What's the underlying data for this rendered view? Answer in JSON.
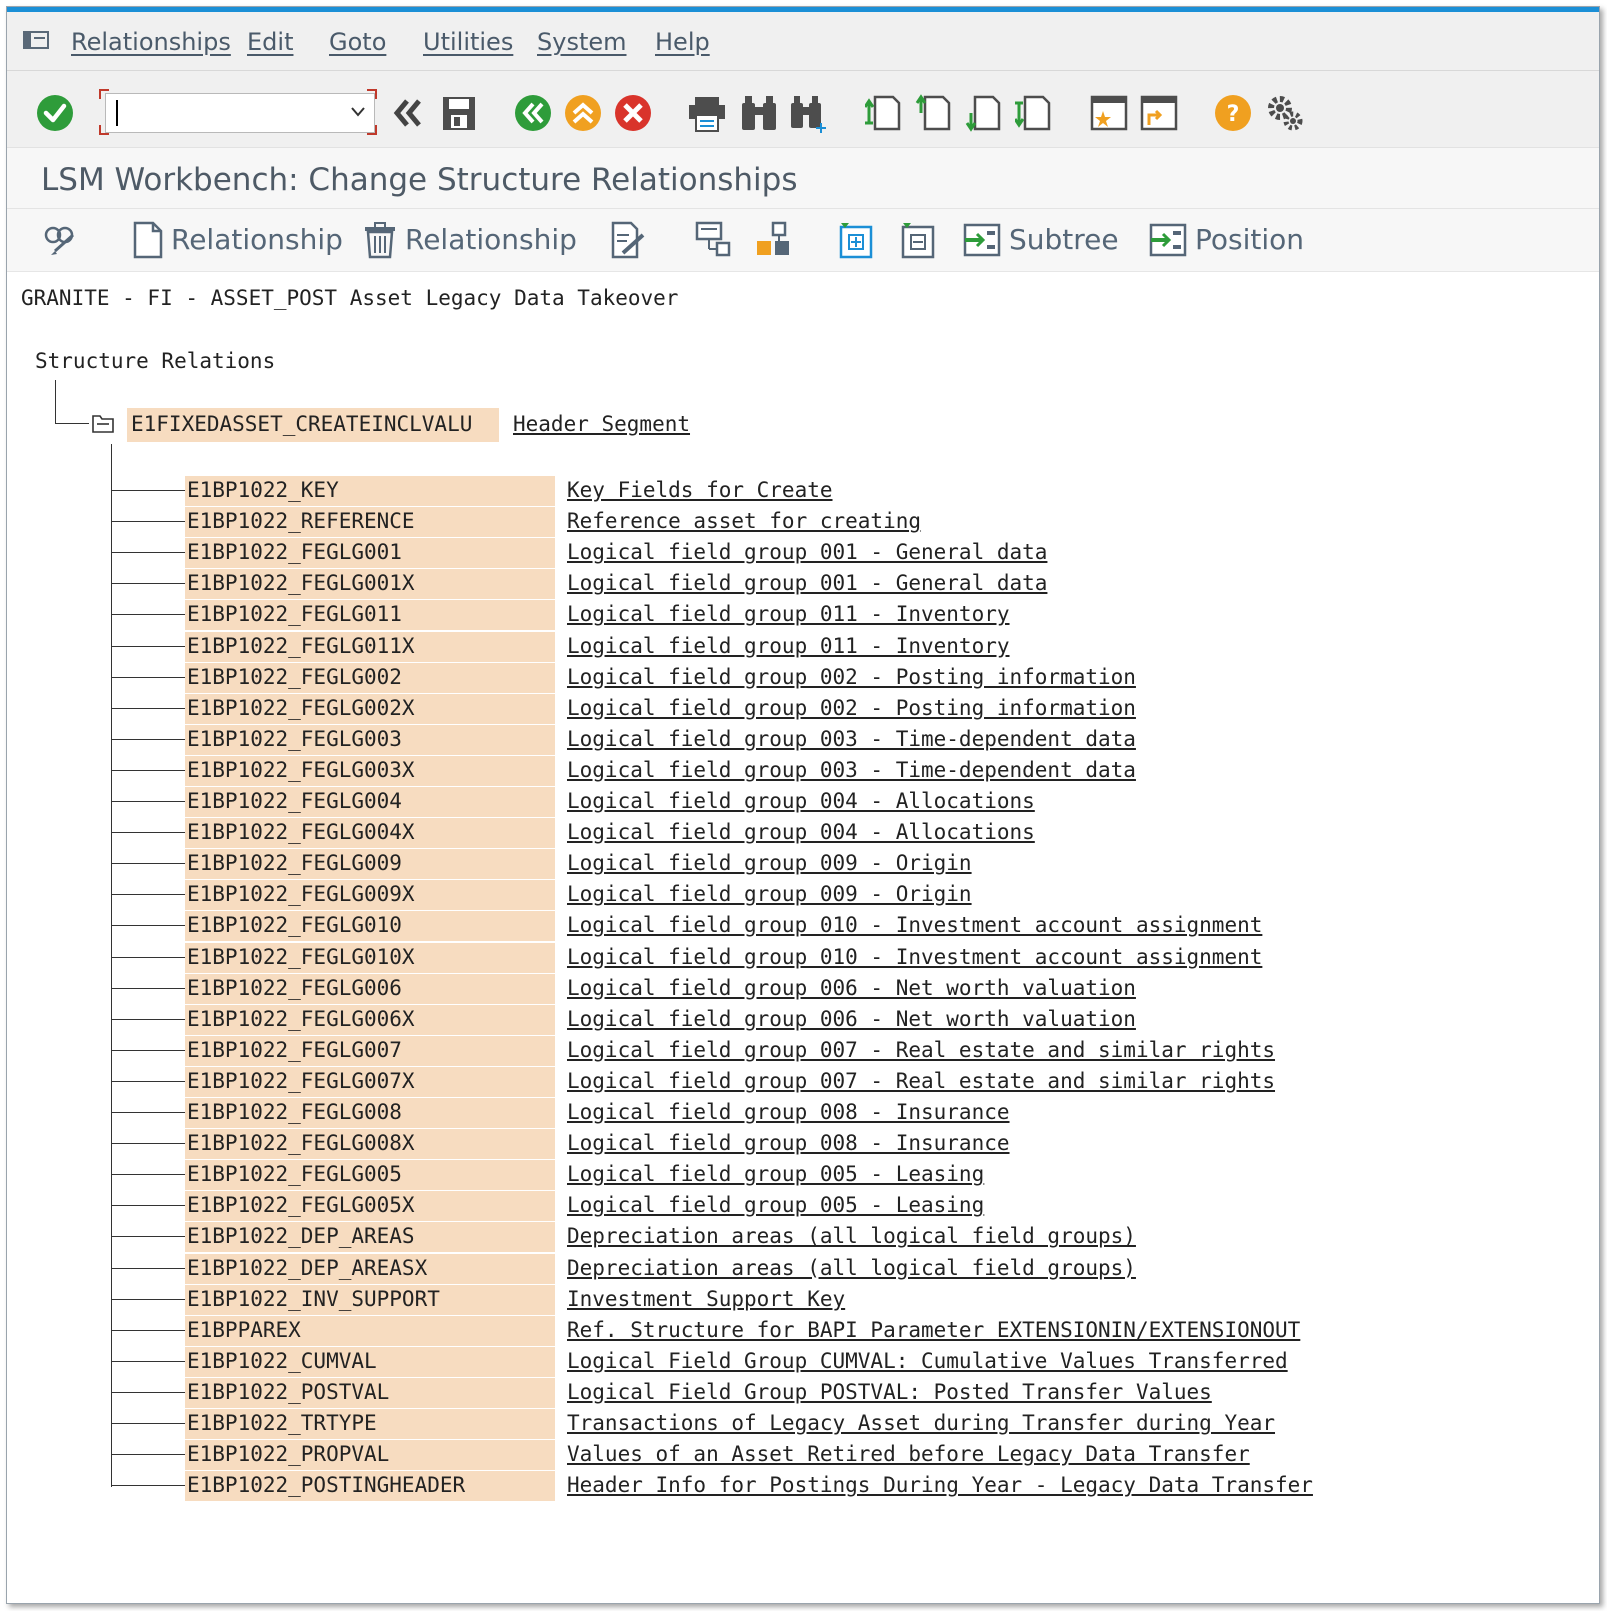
{
  "menubar": {
    "items": [
      "Relationships",
      "Edit",
      "Goto",
      "Utilities",
      "System",
      "Help"
    ]
  },
  "toolbar": {
    "command_field_value": "",
    "icons": [
      "enter-icon",
      "command-field",
      "back-double-icon",
      "save-icon",
      "back-icon",
      "exit-icon",
      "cancel-icon",
      "print-icon",
      "find-icon",
      "find-next-icon",
      "first-page-icon",
      "previous-page-icon",
      "next-page-icon",
      "last-page-icon",
      "create-session-icon",
      "generate-shortcut-icon",
      "help-icon",
      "customize-layout-icon"
    ]
  },
  "title_bar": {
    "title": "LSM Workbench: Change Structure Relationships"
  },
  "app_toolbar": {
    "create_relationship_label": "Relationship",
    "delete_relationship_label": "Relationship",
    "subtree_label": "Subtree",
    "position_label": "Position"
  },
  "content": {
    "heading": "GRANITE - FI - ASSET_POST Asset Legacy Data Takeover",
    "root_label": "Structure Relations",
    "root_segment": "E1FIXEDASSET_CREATEINCLVALU",
    "root_description": "Header Segment",
    "segments": [
      {
        "name": "E1BP1022_KEY",
        "desc": "Key Fields for Create"
      },
      {
        "name": "E1BP1022_REFERENCE",
        "desc": "Reference asset for creating"
      },
      {
        "name": "E1BP1022_FEGLG001",
        "desc": "Logical field group 001 - General data"
      },
      {
        "name": "E1BP1022_FEGLG001X",
        "desc": "Logical field group 001 - General data"
      },
      {
        "name": "E1BP1022_FEGLG011",
        "desc": "Logical field group 011 - Inventory"
      },
      {
        "name": "E1BP1022_FEGLG011X",
        "desc": "Logical field group 011 - Inventory"
      },
      {
        "name": "E1BP1022_FEGLG002",
        "desc": "Logical field group 002 - Posting information"
      },
      {
        "name": "E1BP1022_FEGLG002X",
        "desc": "Logical field group 002 - Posting information"
      },
      {
        "name": "E1BP1022_FEGLG003",
        "desc": "Logical field group 003 - Time-dependent data"
      },
      {
        "name": "E1BP1022_FEGLG003X",
        "desc": "Logical field group 003 - Time-dependent data"
      },
      {
        "name": "E1BP1022_FEGLG004",
        "desc": "Logical field group 004 - Allocations"
      },
      {
        "name": "E1BP1022_FEGLG004X",
        "desc": "Logical field group 004 - Allocations"
      },
      {
        "name": "E1BP1022_FEGLG009",
        "desc": "Logical field group 009 - Origin"
      },
      {
        "name": "E1BP1022_FEGLG009X",
        "desc": "Logical field group 009 - Origin"
      },
      {
        "name": "E1BP1022_FEGLG010",
        "desc": "Logical field group 010 - Investment account assignment"
      },
      {
        "name": "E1BP1022_FEGLG010X",
        "desc": "Logical field group 010 - Investment account assignment"
      },
      {
        "name": "E1BP1022_FEGLG006",
        "desc": "Logical field group 006 - Net worth valuation"
      },
      {
        "name": "E1BP1022_FEGLG006X",
        "desc": "Logical field group 006 - Net worth valuation"
      },
      {
        "name": "E1BP1022_FEGLG007",
        "desc": "Logical field group 007 - Real estate and similar rights"
      },
      {
        "name": "E1BP1022_FEGLG007X",
        "desc": "Logical field group 007 - Real estate and similar rights"
      },
      {
        "name": "E1BP1022_FEGLG008",
        "desc": "Logical field group 008 - Insurance"
      },
      {
        "name": "E1BP1022_FEGLG008X",
        "desc": "Logical field group 008 - Insurance"
      },
      {
        "name": "E1BP1022_FEGLG005",
        "desc": "Logical field group 005 - Leasing"
      },
      {
        "name": "E1BP1022_FEGLG005X",
        "desc": "Logical field group 005 - Leasing"
      },
      {
        "name": "E1BP1022_DEP_AREAS",
        "desc": "Depreciation areas (all logical field groups)"
      },
      {
        "name": "E1BP1022_DEP_AREASX",
        "desc": "Depreciation areas (all logical field groups)"
      },
      {
        "name": "E1BP1022_INV_SUPPORT",
        "desc": "Investment Support Key"
      },
      {
        "name": "E1BPPAREX",
        "desc": "Ref. Structure for BAPI Parameter EXTENSIONIN/EXTENSIONOUT"
      },
      {
        "name": "E1BP1022_CUMVAL",
        "desc": "Logical Field Group CUMVAL: Cumulative Values Transferred"
      },
      {
        "name": "E1BP1022_POSTVAL",
        "desc": "Logical Field Group POSTVAL: Posted Transfer Values"
      },
      {
        "name": "E1BP1022_TRTYPE",
        "desc": "Transactions of Legacy Asset during Transfer during Year"
      },
      {
        "name": "E1BP1022_PROPVAL",
        "desc": "Values of an Asset Retired before Legacy Data Transfer"
      },
      {
        "name": "E1BP1022_POSTINGHEADER",
        "desc": "Header Info for Postings During Year - Legacy Data Transfer"
      }
    ]
  },
  "colors": {
    "accent_line": "#1b8fd6",
    "segment_highlight": "#f7dcc0",
    "enter_green": "#2e9c3a",
    "back_green": "#2e9c3a",
    "exit_orange": "#f0a020",
    "cancel_red": "#d9342b",
    "help_orange": "#f0a020"
  }
}
